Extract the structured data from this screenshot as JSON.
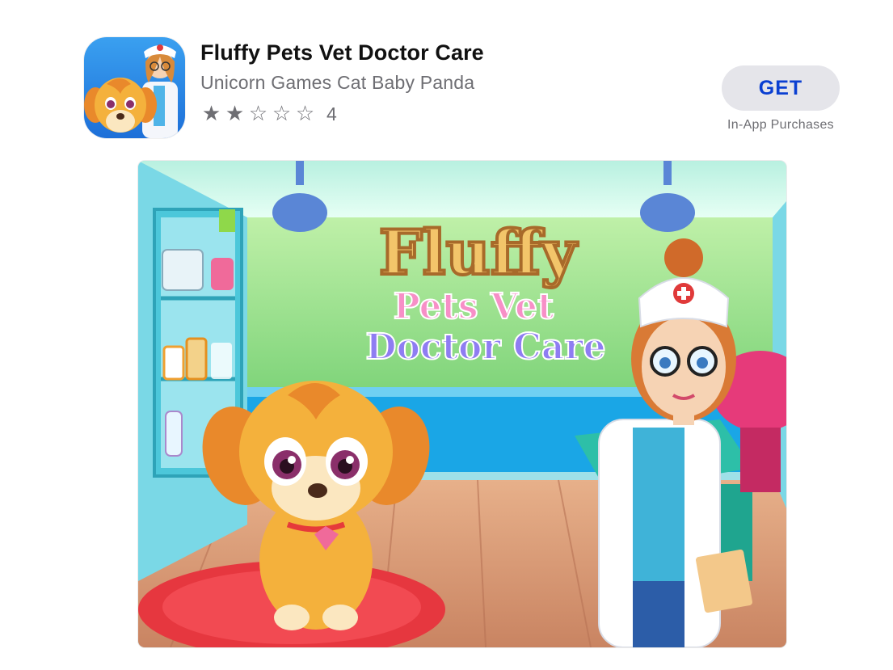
{
  "app": {
    "title": "Fluffy Pets Vet Doctor Care",
    "developer": "Unicorn Games Cat Baby Panda",
    "rating": {
      "value": 2,
      "max": 5,
      "count": "4"
    },
    "icon": "app-icon-puppy-and-nurse"
  },
  "actions": {
    "get_label": "GET",
    "iap_label": "In-App Purchases"
  },
  "screenshot": {
    "logo_line1": "Fluffy",
    "logo_line2": "Pets Vet",
    "logo_line3": "Doctor Care"
  },
  "colors": {
    "accent": "#0a3fd1",
    "button_bg": "#e5e5ea",
    "secondary_text": "#6e6e73"
  }
}
